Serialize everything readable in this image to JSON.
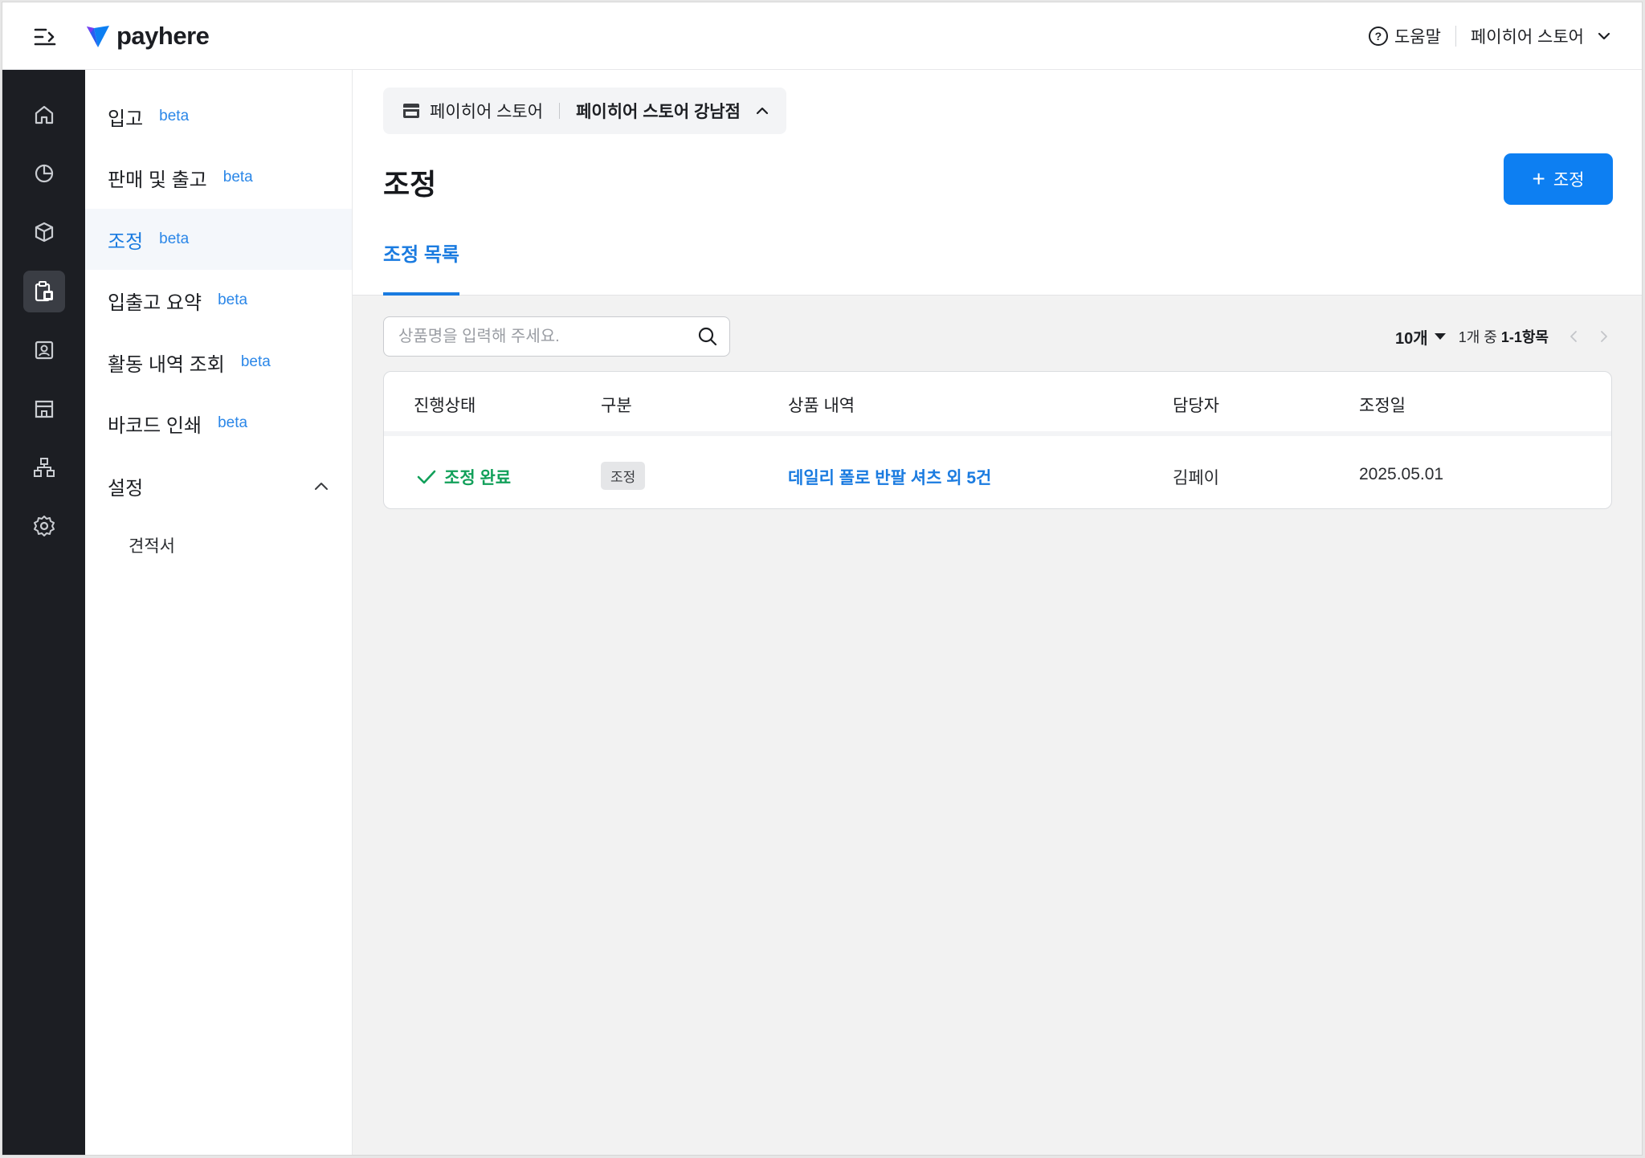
{
  "header": {
    "logo_text": "payhere",
    "help_label": "도움말",
    "store_name": "페이히어 스토어"
  },
  "rail": {
    "items": [
      "home-icon",
      "pie-chart-icon",
      "box-icon",
      "inventory-clipboard-icon",
      "contact-card-icon",
      "store-icon",
      "org-chart-icon",
      "gear-icon"
    ],
    "active": "inventory-clipboard-icon"
  },
  "submenu": {
    "items": [
      {
        "label": "입고",
        "badge": "beta"
      },
      {
        "label": "판매 및 출고",
        "badge": "beta"
      },
      {
        "label": "조정",
        "badge": "beta"
      },
      {
        "label": "입출고 요약",
        "badge": "beta"
      },
      {
        "label": "활동 내역 조회",
        "badge": "beta"
      },
      {
        "label": "바코드 인쇄",
        "badge": "beta"
      }
    ],
    "active_index": 2,
    "group": {
      "label": "설정",
      "children": [
        "견적서"
      ]
    }
  },
  "breadcrumb": {
    "parent": "페이히어 스토어",
    "current": "페이히어 스토어 강남점"
  },
  "page": {
    "title": "조정",
    "add_button": "조정",
    "tab": "조정 목록"
  },
  "search": {
    "placeholder": "상품명을 입력해 주세요.",
    "value": ""
  },
  "pager": {
    "page_size": "10개",
    "range_prefix": "1개 중",
    "range": "1-1항목"
  },
  "table": {
    "columns": [
      "진행상태",
      "구분",
      "상품 내역",
      "담당자",
      "조정일"
    ],
    "rows": [
      {
        "status": "조정 완료",
        "type": "조정",
        "product": "데일리 폴로 반팔 셔츠 외 5건",
        "manager": "김페이",
        "date": "2025.05.01"
      }
    ]
  },
  "colors": {
    "accent": "#0d7ff2",
    "success": "#12a05a",
    "rail_bg": "#1c1e23"
  }
}
